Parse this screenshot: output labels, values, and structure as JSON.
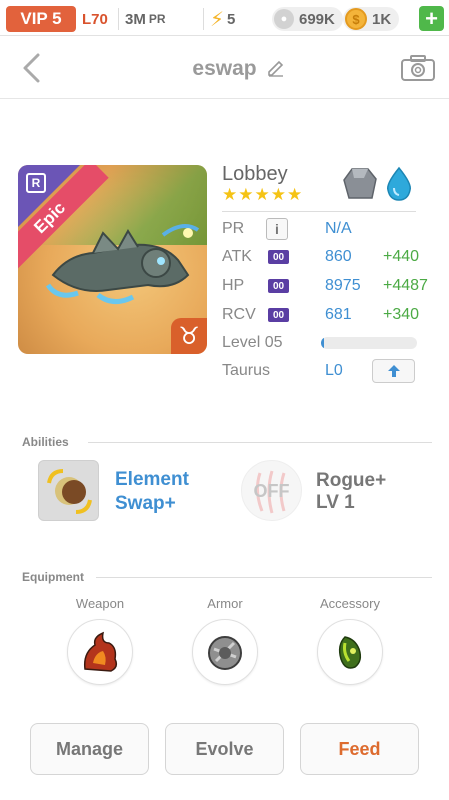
{
  "status_bar": {
    "vip": "VIP 5",
    "level": "L70",
    "pr_value": "3M",
    "pr_unit": "PR",
    "energy": "5",
    "paws": "699K",
    "coins": "1K",
    "plus": "+"
  },
  "nav": {
    "title": "eswap"
  },
  "card": {
    "rarity": "Epic",
    "rank_badge": "R",
    "zodiac_symbol": "♉"
  },
  "monster": {
    "name": "Lobbey",
    "stars": "★★★★★",
    "stats": {
      "pr": {
        "label": "PR",
        "value": "N/A"
      },
      "atk": {
        "label": "ATK",
        "value": "860",
        "bonus": "+440",
        "badge": "00"
      },
      "hp": {
        "label": "HP",
        "value": "8975",
        "bonus": "+4487",
        "badge": "00"
      },
      "rcv": {
        "label": "RCV",
        "value": "681",
        "bonus": "+340",
        "badge": "00"
      }
    },
    "level_label": "Level 05",
    "level_progress": 0.03,
    "sign": "Taurus",
    "sign_level": "L0"
  },
  "abilities": {
    "header": "Abilities",
    "ability1": {
      "line1": "Element",
      "line2": "Swap+"
    },
    "ability2": {
      "status": "OFF",
      "line1": "Rogue+",
      "line2": "LV 1"
    }
  },
  "equipment": {
    "header": "Equipment",
    "weapon": "Weapon",
    "armor": "Armor",
    "accessory": "Accessory"
  },
  "actions": {
    "manage": "Manage",
    "evolve": "Evolve",
    "feed": "Feed"
  },
  "colors": {
    "accent_blue": "#3f8fd2",
    "bonus_green": "#4caa45",
    "vip_orange": "#e2623c",
    "feed_orange": "#dd6b2e"
  }
}
